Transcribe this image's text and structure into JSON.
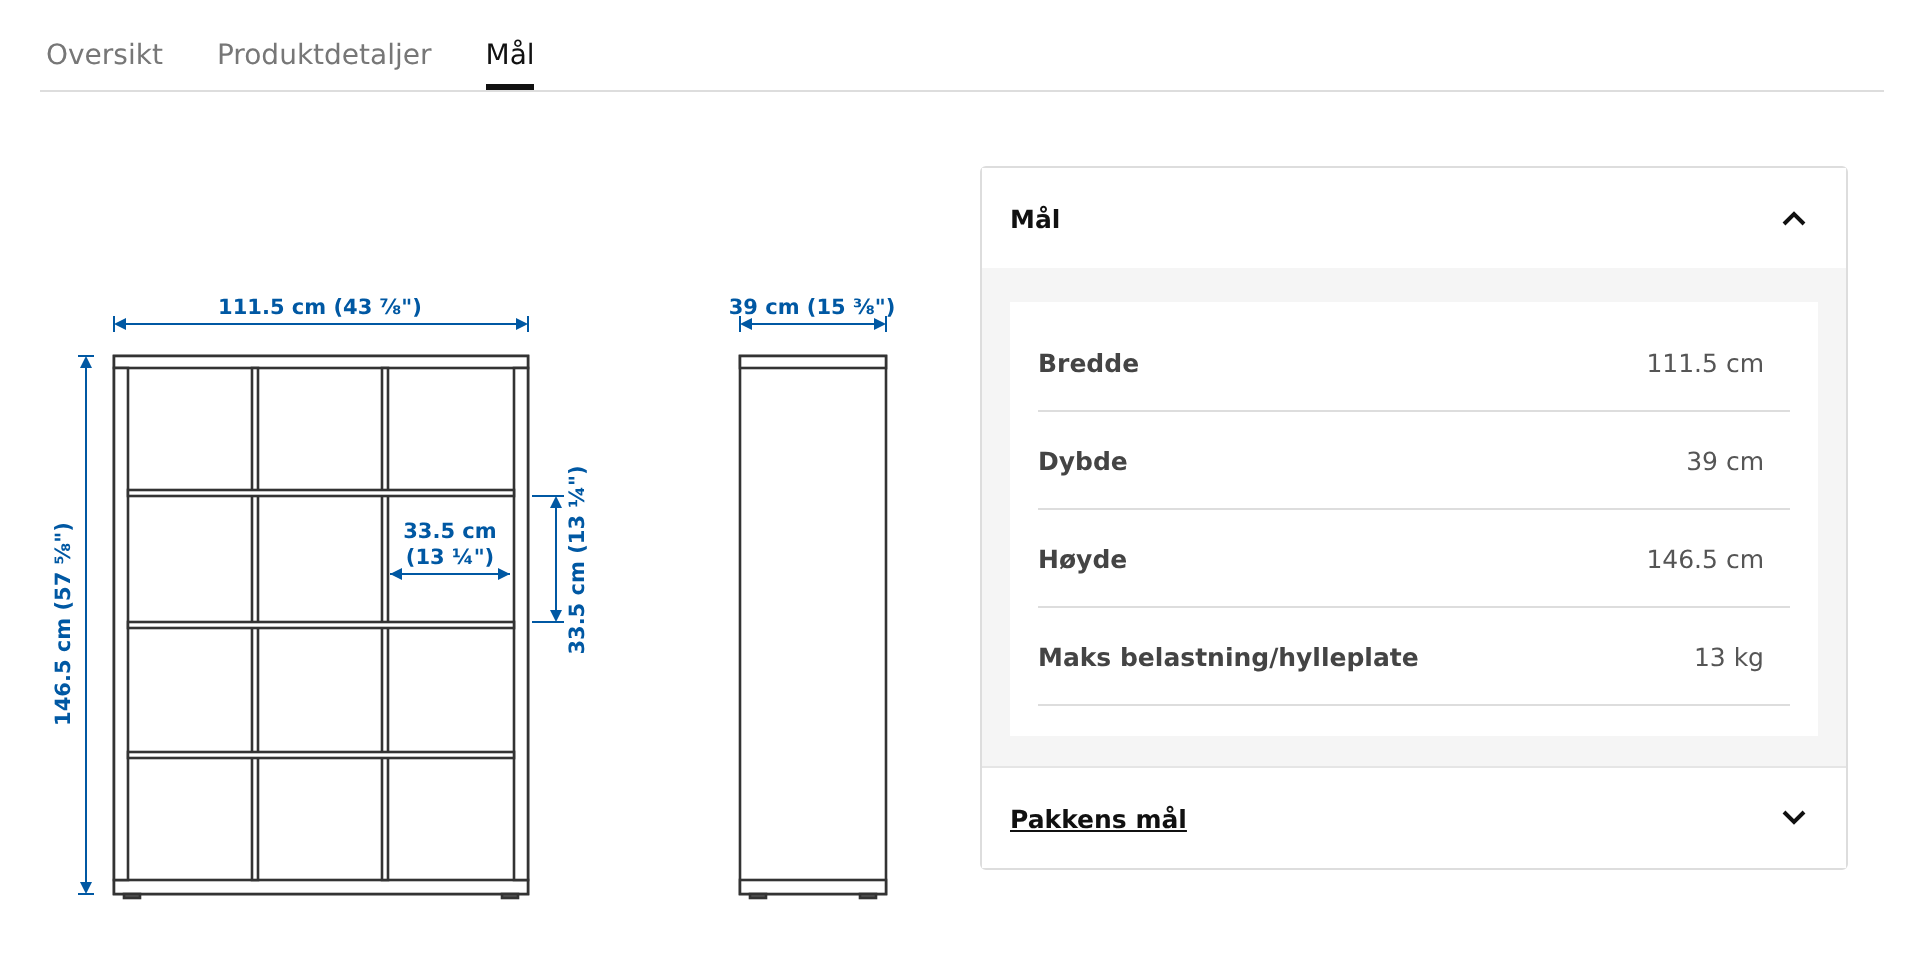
{
  "tabs": [
    {
      "label": "Oversikt",
      "selected": false
    },
    {
      "label": "Produktdetaljer",
      "selected": false
    },
    {
      "label": "Mål",
      "selected": true
    }
  ],
  "drawing": {
    "width_label": "111.5 cm (43 ⅞\")",
    "height_label": "146.5 cm (57 ⅝\")",
    "cell_width_label": [
      "33.5 cm",
      "(13 ¼\")"
    ],
    "cell_height_label": "33.5 cm (13 ¼\")",
    "depth_label": "39 cm (15 ⅜\")"
  },
  "sections": [
    {
      "title": "Mål",
      "expanded": true,
      "rows": [
        {
          "label": "Bredde",
          "value": "111.5 cm"
        },
        {
          "label": "Dybde",
          "value": "39 cm"
        },
        {
          "label": "Høyde",
          "value": "146.5 cm"
        },
        {
          "label": "Maks belastning/hylleplate",
          "value": "13 kg"
        }
      ]
    },
    {
      "title": "Pakkens mål",
      "expanded": false
    }
  ]
}
